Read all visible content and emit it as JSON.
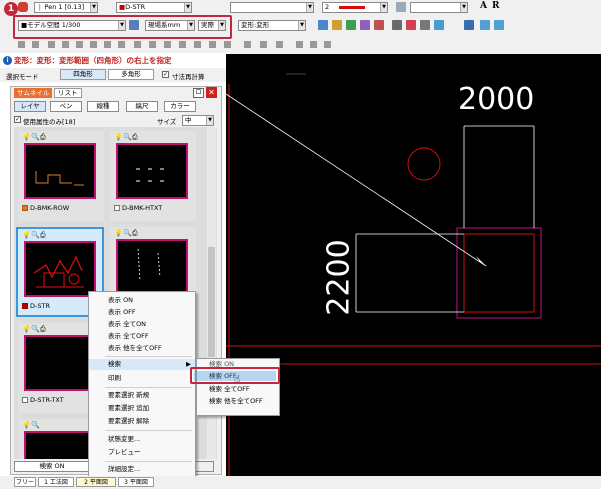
{
  "toolbar_top": {
    "pen_combo": "Pen 1 [0.13]",
    "layer_combo": "D-STR",
    "linecolor_combo": "2"
  },
  "toolbar_second": {
    "space_combo": "モデル空間 1/300",
    "unit_combo": "現場系mm",
    "scale_combo": "実際",
    "edit_combo": "変形:変形"
  },
  "callout_badge": "1",
  "status_instruction": "変形：変形：変形範囲（四角形）の右上を指定",
  "mode_row": {
    "select_mode_label": "選択モード",
    "rect_button": "四角形",
    "polygon_button": "多角形",
    "recalc_checkbox_label": "寸法再計算",
    "recalc_checked": true
  },
  "panel": {
    "tab_thumbnail": "サムネイル",
    "tab_list": "リスト",
    "buttons": [
      "レイヤ",
      "ペン",
      "線種",
      "縞尺",
      "カラー"
    ],
    "used_only_label": "使用属性のみ[18]",
    "size_label": "サイズ",
    "size_value": "中"
  },
  "thumbnails": [
    {
      "label": "D-BMK-ROW",
      "swatch": "orange"
    },
    {
      "label": "D-BMK-HTXT",
      "swatch": "white"
    },
    {
      "label": "D-STR",
      "swatch": "red"
    },
    {
      "label": "",
      "swatch": "white"
    },
    {
      "label": "D-STR-TXT",
      "swatch": "white"
    },
    {
      "label": "",
      "swatch": "white"
    }
  ],
  "context_menu": {
    "items": [
      "表示 ON",
      "表示 OFF",
      "表示 全てON",
      "表示 全てOFF",
      "表示 他を全てOFF",
      "検索",
      "印刷",
      "要素選択 新規",
      "要素選択 追加",
      "要素選択 解除",
      "状態変更...",
      "プレビュー",
      "詳細設定..."
    ],
    "highlighted_index": 5
  },
  "submenu": {
    "items": [
      "検索 ON",
      "検索 OFF",
      "検索 全てOFF",
      "検索 他を全てOFF"
    ],
    "highlighted_index": 1
  },
  "search_on_button": "検索 ON",
  "status_tabs": [
    "フリー",
    "1 工法図",
    "2 平面図",
    "3 平面図"
  ],
  "cad": {
    "dim_horizontal": "2000",
    "dim_vertical": "2200"
  },
  "colors": {
    "accent_red": "#c0283e",
    "cad_background": "#000000",
    "cad_red": "#d01010",
    "cad_magenta": "#c01080",
    "selection_blue": "#3c97e0"
  }
}
